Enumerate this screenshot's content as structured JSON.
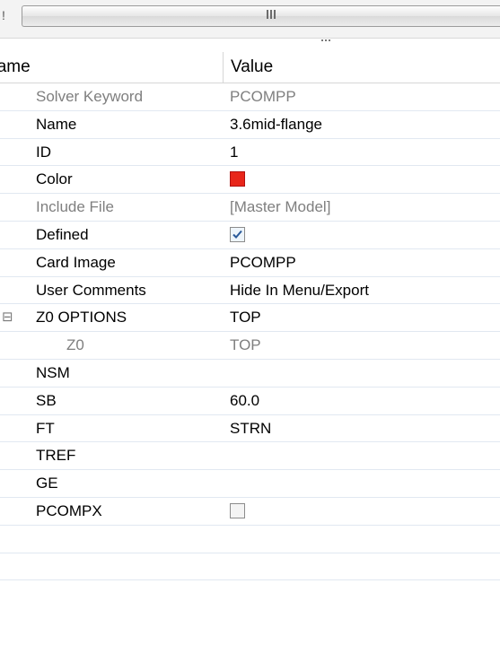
{
  "scrollbar": {
    "left_mark": "!"
  },
  "header": {
    "name_label": "Name",
    "value_label": "Value"
  },
  "rows": [
    {
      "name": "Solver Keyword",
      "value": "PCOMPP"
    },
    {
      "name": "Name",
      "value": "3.6mid-flange"
    },
    {
      "name": "ID",
      "value": "1"
    },
    {
      "name": "Color",
      "value": "",
      "color": "#e8261a"
    },
    {
      "name": "Include File",
      "value": "[Master Model]"
    },
    {
      "name": "Defined",
      "value": "",
      "checked": true
    },
    {
      "name": "Card Image",
      "value": "PCOMPP"
    },
    {
      "name": "User Comments",
      "value": "Hide In Menu/Export"
    },
    {
      "name": "Z0 OPTIONS",
      "value": "TOP",
      "expander": "⊟"
    },
    {
      "name": "Z0",
      "value": "TOP"
    },
    {
      "name": "NSM",
      "value": ""
    },
    {
      "name": "SB",
      "value": "60.0"
    },
    {
      "name": "FT",
      "value": "STRN"
    },
    {
      "name": "TREF",
      "value": ""
    },
    {
      "name": "GE",
      "value": ""
    },
    {
      "name": "PCOMPX",
      "value": "",
      "checked": false
    }
  ]
}
